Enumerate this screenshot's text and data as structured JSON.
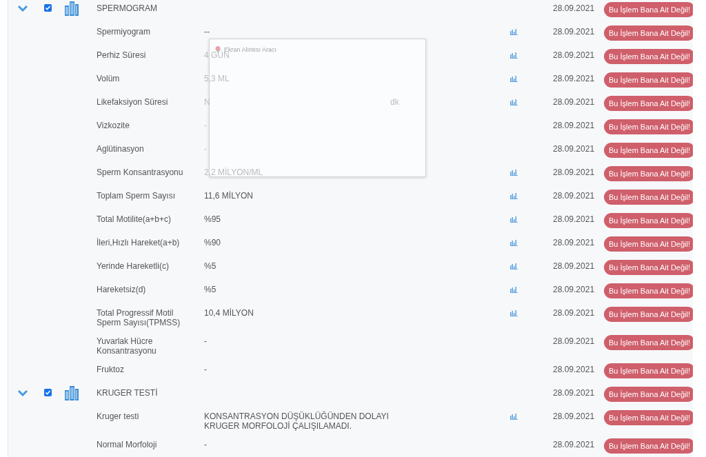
{
  "snip_overlay": {
    "title": "Ekran Alıntısı Aracı"
  },
  "rows": [
    {
      "kind": "group",
      "name": "SPERMOGRAM",
      "expanded": true,
      "checked": true,
      "date": "28.09.2021",
      "action": "Bu İşlem Bana Ait Değil!"
    },
    {
      "kind": "item",
      "name": "Spermiyogram",
      "value": "--",
      "dimmed": false,
      "chart": true,
      "date": "28.09.2021",
      "action": "Bu İşlem Bana Ait Değil!"
    },
    {
      "kind": "item",
      "name": "Perhiz Süresi",
      "value": "4 GÜN",
      "dimmed": true,
      "chart": true,
      "date": "28.09.2021",
      "action": "Bu İşlem Bana Ait Değil!"
    },
    {
      "kind": "item",
      "name": "Volüm",
      "value": "5,3 ML",
      "dimmed": true,
      "chart": true,
      "date": "28.09.2021",
      "action": "Bu İşlem Bana Ait Değil!"
    },
    {
      "kind": "item",
      "name": "Likefaksiyon Süresi",
      "value": "N",
      "unit": "dk",
      "dimmed": true,
      "chart": true,
      "date": "28.09.2021",
      "action": "Bu İşlem Bana Ait Değil!"
    },
    {
      "kind": "item",
      "name": "Vizkozite",
      "value": "-",
      "dimmed": true,
      "chart": false,
      "date": "28.09.2021",
      "action": "Bu İşlem Bana Ait Değil!"
    },
    {
      "kind": "item",
      "name": "Aglütinasyon",
      "value": "-",
      "dimmed": true,
      "chart": false,
      "date": "28.09.2021",
      "action": "Bu İşlem Bana Ait Değil!"
    },
    {
      "kind": "item",
      "name": "Sperm Konsantrasyonu",
      "value": "2,2 MİLYON/ML",
      "dimmed": true,
      "chart": true,
      "date": "28.09.2021",
      "action": "Bu İşlem Bana Ait Değil!"
    },
    {
      "kind": "item",
      "name": "Toplam Sperm Sayısı",
      "value": "11,6 MİLYON",
      "dimmed": false,
      "chart": true,
      "date": "28.09.2021",
      "action": "Bu İşlem Bana Ait Değil!"
    },
    {
      "kind": "item",
      "name": "Total Motilite(a+b+c)",
      "value": "%95",
      "dimmed": false,
      "chart": true,
      "date": "28.09.2021",
      "action": "Bu İşlem Bana Ait Değil!"
    },
    {
      "kind": "item",
      "name": "İleri,Hızlı Hareket(a+b)",
      "value": "%90",
      "dimmed": false,
      "chart": true,
      "date": "28.09.2021",
      "action": "Bu İşlem Bana Ait Değil!"
    },
    {
      "kind": "item",
      "name": "Yerinde Hareketli(c)",
      "value": "%5",
      "dimmed": false,
      "chart": true,
      "date": "28.09.2021",
      "action": "Bu İşlem Bana Ait Değil!"
    },
    {
      "kind": "item",
      "name": "Hareketsiz(d)",
      "value": "%5",
      "dimmed": false,
      "chart": true,
      "date": "28.09.2021",
      "action": "Bu İşlem Bana Ait Değil!"
    },
    {
      "kind": "item",
      "name": "Total Progressif Motil Sperm Sayısı(TPMSS)",
      "value": "10,4 MİLYON",
      "dimmed": false,
      "chart": true,
      "date": "28.09.2021",
      "action": "Bu İşlem Bana Ait Değil!"
    },
    {
      "kind": "item",
      "name": "Yuvarlak Hücre Konsantrasyonu",
      "value": "-",
      "dimmed": false,
      "chart": false,
      "date": "28.09.2021",
      "action": "Bu İşlem Bana Ait Değil!"
    },
    {
      "kind": "item",
      "name": "Fruktoz",
      "value": "-",
      "dimmed": false,
      "chart": false,
      "date": "28.09.2021",
      "action": "Bu İşlem Bana Ait Değil!"
    },
    {
      "kind": "group",
      "name": "KRUGER TESTİ",
      "expanded": true,
      "checked": true,
      "date": "28.09.2021",
      "action": "Bu İşlem Bana Ait Değil!"
    },
    {
      "kind": "item",
      "name": "Kruger testi",
      "value": "KONSANTRASYON DÜŞÜKLÜĞÜNDEN DOLAYI KRUGER MORFOLOJİ ÇALIŞILAMADI.",
      "dimmed": false,
      "chart": true,
      "date": "28.09.2021",
      "action": "Bu İşlem Bana Ait Değil!"
    },
    {
      "kind": "item",
      "name": "Normal Morfoloji",
      "value": "-",
      "dimmed": false,
      "chart": false,
      "date": "28.09.2021",
      "action": "Bu İşlem Bana Ait Değil!"
    }
  ]
}
